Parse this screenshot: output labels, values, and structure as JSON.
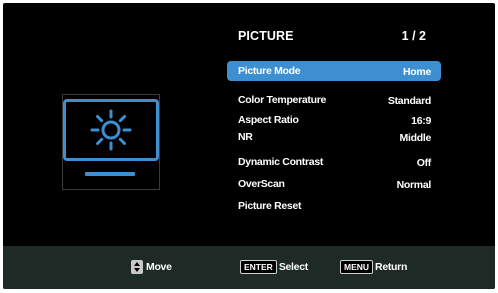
{
  "menu": {
    "title": "PICTURE",
    "page": "1 / 2",
    "items": [
      {
        "label": "Picture Mode",
        "value": "Home"
      },
      {
        "label": "Color Temperature",
        "value": "Standard"
      },
      {
        "label": "Aspect Ratio",
        "value": "16:9"
      },
      {
        "label": "NR",
        "value": "Middle"
      },
      {
        "label": "Dynamic Contrast",
        "value": "Off"
      },
      {
        "label": "OverScan",
        "value": "Normal"
      },
      {
        "label": "Picture Reset",
        "value": ""
      }
    ],
    "selected_index": 0
  },
  "footer": {
    "move_label": "Move",
    "enter_key": "ENTER",
    "select_label": "Select",
    "menu_key": "MENU",
    "return_label": "Return"
  },
  "icons": {
    "category": "monitor-brightness-icon",
    "move": "up-down-arrow-icon"
  },
  "colors": {
    "accent": "#3d8fd1",
    "background": "#000000",
    "footer": "#1d2a26"
  }
}
